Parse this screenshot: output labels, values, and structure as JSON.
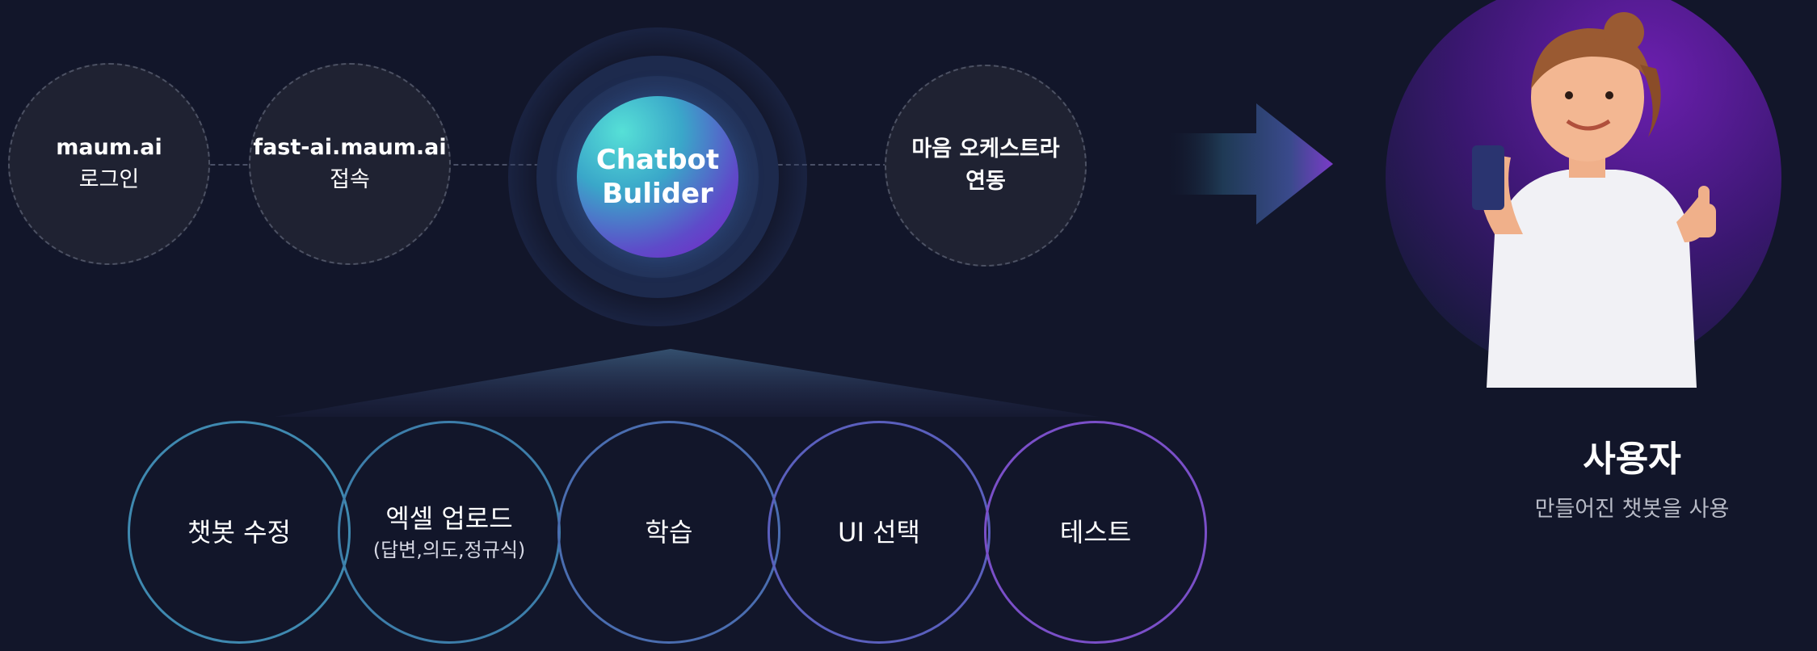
{
  "steps": [
    {
      "line1": "maum.ai",
      "line2": "로그인"
    },
    {
      "line1": "fast-ai.maum.ai",
      "line2": "접속"
    },
    {
      "line1": "마음 오케스트라",
      "line2": "연동"
    }
  ],
  "core": {
    "line1": "Chatbot",
    "line2": "Bulider"
  },
  "features": [
    {
      "label": "챗봇 수정",
      "sub": ""
    },
    {
      "label": "엑셀 업로드",
      "sub": "(답변,의도,정규식)"
    },
    {
      "label": "학습",
      "sub": ""
    },
    {
      "label": "UI 선택",
      "sub": ""
    },
    {
      "label": "테스트",
      "sub": ""
    }
  ],
  "user": {
    "title": "사용자",
    "subtitle": "만들어진 챗봇을 사용"
  },
  "icons": {
    "arrow": "arrow-right-icon",
    "user_illustration": "woman-thumbs-up-phone-illustration"
  },
  "colors": {
    "background": "#12162a",
    "cyan": "#4fd3d4",
    "purple": "#7b1ec7",
    "ring_start": "#3d7aa0",
    "ring_end": "#7a4fc8"
  }
}
